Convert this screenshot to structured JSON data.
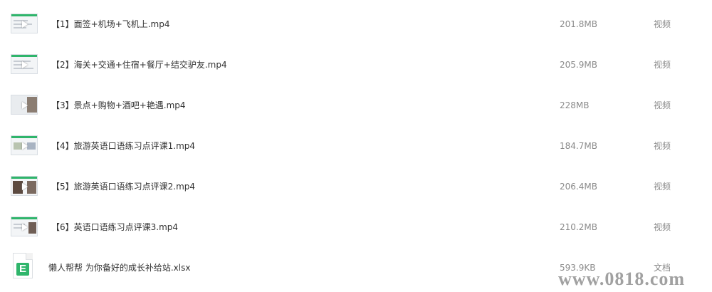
{
  "files": [
    {
      "name": "【1】面签+机场+飞机上.mp4",
      "size": "201.8MB",
      "type": "视频",
      "icon": "video-thumbnail-icon"
    },
    {
      "name": "【2】海关+交通+住宿+餐厅+结交驴友.mp4",
      "size": "205.9MB",
      "type": "视频",
      "icon": "video-thumbnail-icon"
    },
    {
      "name": "【3】景点+购物+酒吧+艳遇.mp4",
      "size": "228MB",
      "type": "视频",
      "icon": "video-thumbnail-icon"
    },
    {
      "name": "【4】旅游英语口语练习点评课1.mp4",
      "size": "184.7MB",
      "type": "视频",
      "icon": "video-thumbnail-icon"
    },
    {
      "name": "【5】旅游英语口语练习点评课2.mp4",
      "size": "206.4MB",
      "type": "视频",
      "icon": "video-thumbnail-icon"
    },
    {
      "name": "【6】英语口语练习点评课3.mp4",
      "size": "210.2MB",
      "type": "视频",
      "icon": "video-thumbnail-icon"
    },
    {
      "name": "懒人帮帮   为你备好的成长补给站.xlsx",
      "size": "593.9KB",
      "type": "文档",
      "icon": "excel-file-icon"
    }
  ],
  "excel_icon_letter": "E",
  "watermark": "www.0818.com",
  "colors": {
    "accent_green": "#2fb56b",
    "meta_text": "#8a8a8a"
  }
}
